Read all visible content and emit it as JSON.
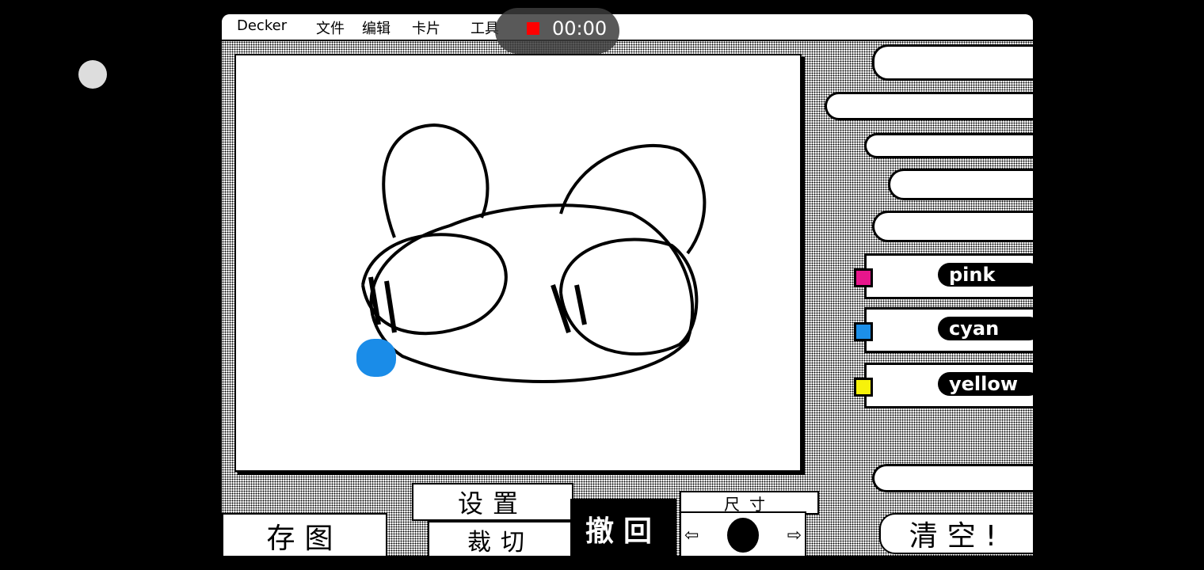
{
  "menu": {
    "app": "Decker",
    "items": [
      "文件",
      "编辑",
      "卡片",
      "工具"
    ]
  },
  "recording": {
    "time": "00:00",
    "color": "#ff0000"
  },
  "markers": [
    {
      "label": "pink",
      "color": "#e8168c"
    },
    {
      "label": "cyan",
      "color": "#1c8fe8"
    },
    {
      "label": "yellow",
      "color": "#f7f20a"
    }
  ],
  "buttons": {
    "save": "存图",
    "settings": "设置",
    "crop": "裁切",
    "undo": "撤回",
    "size": "尺寸",
    "clear": "清空!"
  },
  "brush_color": "#1a8ce8"
}
